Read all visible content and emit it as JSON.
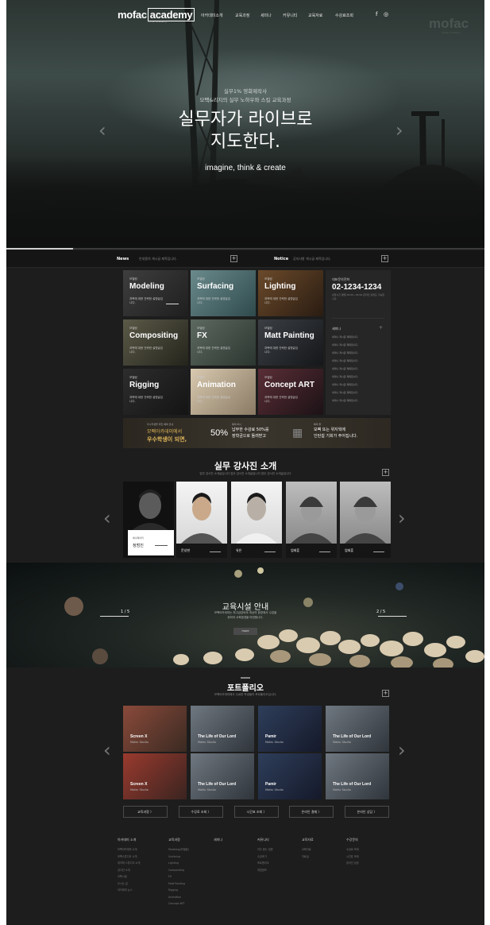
{
  "header": {
    "logo": {
      "part1": "mofac",
      "part2": "academy",
      "sub": "mofac academy"
    },
    "nav": [
      "아카데미소개",
      "교육과정",
      "세미나",
      "커뮤니티",
      "교육자료",
      "수강료조회"
    ],
    "sns": [
      "f",
      "◎"
    ],
    "watermark": "mofac",
    "watermark_sub": "mofac academy"
  },
  "hero": {
    "sub1": "실무1% 영화제작사",
    "sub2": "모팩&리지의 실무 노하우와 스킬 교육과정",
    "title1": "실무자가 라이브로",
    "title2": "지도한다.",
    "tagline": "imagine, think & create",
    "prev_icon": "‹",
    "next_icon": "›",
    "progress": 0.14
  },
  "newsbar": {
    "news_label": "News",
    "news_text": "안내용의 게시글 제목입니다.",
    "notice_label": "Notice",
    "notice_text": "공지사항 게시글 제목입니다.",
    "plus": "+"
  },
  "courses": [
    {
      "cat": "모델링",
      "name": "Modeling",
      "desc": "과목에 대한 간략한 설명글입니다."
    },
    {
      "cat": "모델링",
      "name": "Surfacing",
      "desc": "과목에 대한 간략한 설명글입니다."
    },
    {
      "cat": "모델링",
      "name": "Lighting",
      "desc": "과목에 대한 간략한 설명글입니다."
    },
    {
      "cat": "모델링",
      "name": "Compositing",
      "desc": "과목에 대한 간략한 설명글입니다."
    },
    {
      "cat": "모델링",
      "name": "FX",
      "desc": "과목에 대한 간략한 설명글입니다."
    },
    {
      "cat": "모델링",
      "name": "Matt Painting",
      "desc": "과목에 대한 간략한 설명글입니다."
    },
    {
      "cat": "모델링",
      "name": "Rigging",
      "desc": "과목에 대한 간략한 설명글입니다."
    },
    {
      "cat": "모델링",
      "name": "Animation",
      "desc": "과목에 대한 간략한 설명글입니다."
    },
    {
      "cat": "모델링",
      "name": "Concept ART",
      "desc": "과목에 대한 간략한 설명글입니다."
    }
  ],
  "sidebar": {
    "label": "대표문의전화",
    "phone": "02-1234-1234",
    "info": "상담시간 평일 09:00~18:00 온라인 상담도 가능합니다.",
    "seminar_label": "세미나",
    "plus": "+",
    "seminars": [
      "세미나 게시글 제목입니다.",
      "세미나 게시글 제목입니다.",
      "세미나 게시글 제목입니다.",
      "세미나 게시글 제목입니다.",
      "세미나 게시글 제목입니다.",
      "세미나 게시글 제목입니다.",
      "세미나 게시글 제목입니다.",
      "세미나 게시글 제목입니다.",
      "세미나 게시글 제목입니다."
    ]
  },
  "promo": {
    "line1": "우수학생을 위한 혜택 안내",
    "line2": "모팩아카데미에서",
    "line3": "우수학생이 되면,",
    "pct": "50%",
    "lab1": "혜택 하나",
    "msg1a": "납부한 수강료 50%를",
    "msg1b": "장학금으로 돌려받고",
    "lab2": "혜택 둘",
    "msg2a": "모팩 또는 위지웍에",
    "msg2b": "인턴쉽 기회가 주어집니다."
  },
  "instructors": {
    "title": "실무 강사진 소개",
    "subtitle": "업무 강사진 소개글입니다 업무 강사진 소개글입니다 업무 강사진 소개글입니다",
    "featured": {
      "role": "애니메이터",
      "name": "정범진"
    },
    "people": [
      {
        "name": "문성현"
      },
      {
        "name": "유은"
      },
      {
        "name": "엄태훈"
      },
      {
        "name": "엄태훈"
      }
    ],
    "plus": "+",
    "prev_icon": "‹",
    "next_icon": "›"
  },
  "facility": {
    "title": "교육시설 안내",
    "sub1": "모팩아카데미는 최고급장비와 최상의 환경에서 수업을",
    "sub2": "위하여 교육환경을 마련합니다.",
    "button": "more",
    "page_left": "1 / 5",
    "page_right": "2 / 5"
  },
  "portfolio": {
    "title": "포트폴리오",
    "subtitle": "모팩아카데미에서 수료한 학생들의 포트폴리오입니다.",
    "plus": "+",
    "items": [
      {
        "title": "Screen X",
        "studio": "Mofac Studio"
      },
      {
        "title": "The Life of Our Lord",
        "studio": "Mofac Studio"
      },
      {
        "title": "Pamir",
        "studio": "Mofac Studio"
      },
      {
        "title": "The Life of Our Lord",
        "studio": "Mofac Studio"
      },
      {
        "title": "Screen X",
        "studio": "Mofac Studio"
      },
      {
        "title": "The Life of Our Lord",
        "studio": "Mofac Studio"
      },
      {
        "title": "Pamir",
        "studio": "Mofac Studio"
      },
      {
        "title": "The Life of Our Lord",
        "studio": "Mofac Studio"
      }
    ],
    "prev_icon": "‹",
    "next_icon": "›"
  },
  "quick_links": [
    "교육과정 〉",
    "수강료 조회 〉",
    "시간표 조회 〉",
    "온라인 결제 〉",
    "온라인 상담 〉"
  ],
  "footer": [
    {
      "h": "아카데미 소개",
      "items": [
        "모팩아카데미 소개",
        "모팩스튜디오 소개",
        "위지웍 스튜디오 소개",
        "강사진 소개",
        "교육시설",
        "오시는 길",
        "아카데미 뉴스"
      ]
    },
    {
      "h": "교육과정",
      "items": [
        "Modeling(모델링)",
        "Surfacing",
        "Lighting",
        "Compositing",
        "FX",
        "Matt Painting",
        "Rigging",
        "Animation",
        "Concept ART"
      ]
    },
    {
      "h": "세미나",
      "items": []
    },
    {
      "h": "커뮤니티",
      "items": [
        "자주 묻는 질문",
        "수강후기",
        "포트폴리오",
        "취업정보"
      ]
    },
    {
      "h": "교육자료",
      "items": [
        "교육자료",
        "자료실"
      ]
    },
    {
      "h": "수강문의",
      "items": [
        "수강료 조회",
        "시간표 조회",
        "온라인 상담"
      ]
    }
  ]
}
